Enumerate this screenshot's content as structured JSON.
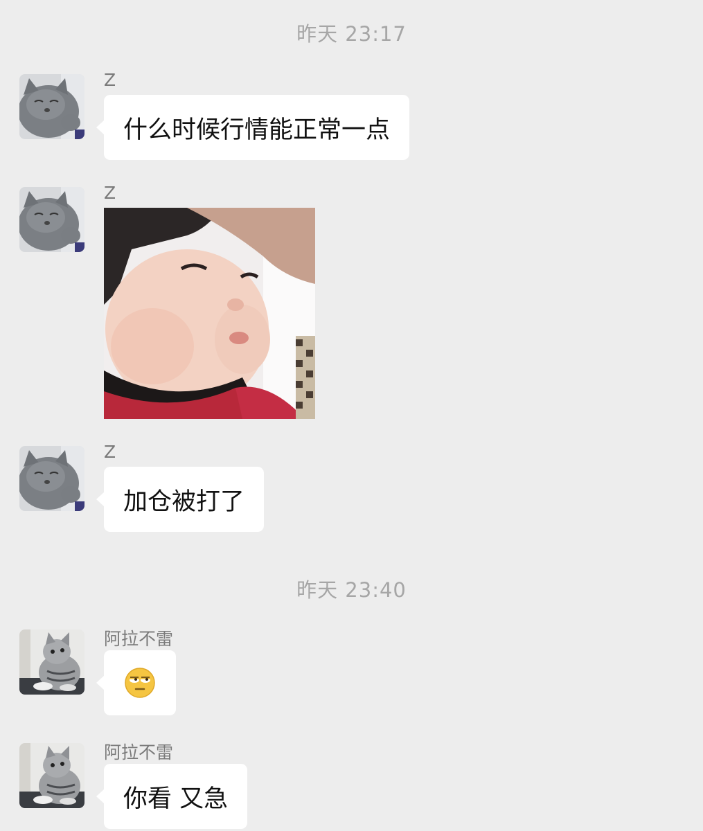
{
  "timestamps": [
    "昨天 23:17",
    "昨天 23:40"
  ],
  "messages": [
    {
      "sender": "Z",
      "text": "什么时候行情能正常一点",
      "avatar_icon": "gray-cat-avatar-icon"
    },
    {
      "sender": "Z",
      "sticker": "baby-face-sticker-icon",
      "avatar_icon": "gray-cat-avatar-icon"
    },
    {
      "sender": "Z",
      "text": "加仓被打了",
      "avatar_icon": "gray-cat-avatar-icon"
    },
    {
      "sender": "阿拉不雷",
      "emoji": "eye-roll-emoji-icon",
      "avatar_icon": "tabby-cat-avatar-icon"
    },
    {
      "sender": "阿拉不雷",
      "text": "你看 又急",
      "avatar_icon": "tabby-cat-avatar-icon"
    }
  ],
  "colors": {
    "background": "#ededed",
    "bubble": "#ffffff",
    "timestamp": "#a6a6a6",
    "sender": "#7a7a7a"
  }
}
